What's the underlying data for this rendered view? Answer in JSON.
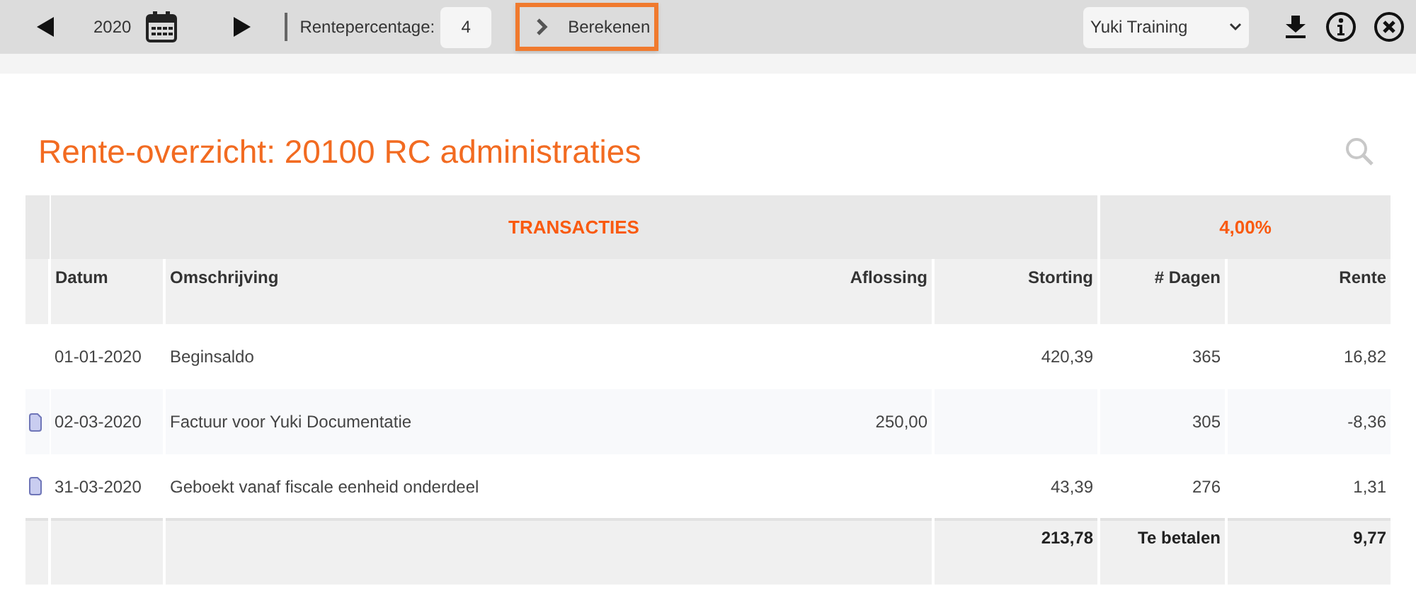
{
  "toolbar": {
    "year": "2020",
    "rate_label": "Rentepercentage:",
    "rate_value": "4",
    "calc_button": "Berekenen",
    "company": "Yuki Training"
  },
  "title": "Rente-overzicht: 20100 RC administraties",
  "table": {
    "group_headers": [
      "TRANSACTIES",
      "4,00%"
    ],
    "columns": [
      "Datum",
      "Omschrijving",
      "Aflossing",
      "Storting",
      "# Dagen",
      "Rente"
    ],
    "rows": [
      {
        "document": false,
        "date": "01-01-2020",
        "description": "Beginsaldo",
        "deposit": "420,39",
        "days": "365",
        "interest": "16,82"
      },
      {
        "document": true,
        "date": "02-03-2020",
        "description": "Factuur voor Yuki Documentatie",
        "repayment": "250,00",
        "days": "305",
        "interest": "-8,36"
      },
      {
        "document": true,
        "date": "31-03-2020",
        "description": "Geboekt vanaf fiscale eenheid onderdeel",
        "deposit": "43,39",
        "days": "276",
        "interest": "1,31"
      }
    ],
    "totals": {
      "deposit": "213,78",
      "days": "Te betalen",
      "interest": "9,77"
    }
  }
}
